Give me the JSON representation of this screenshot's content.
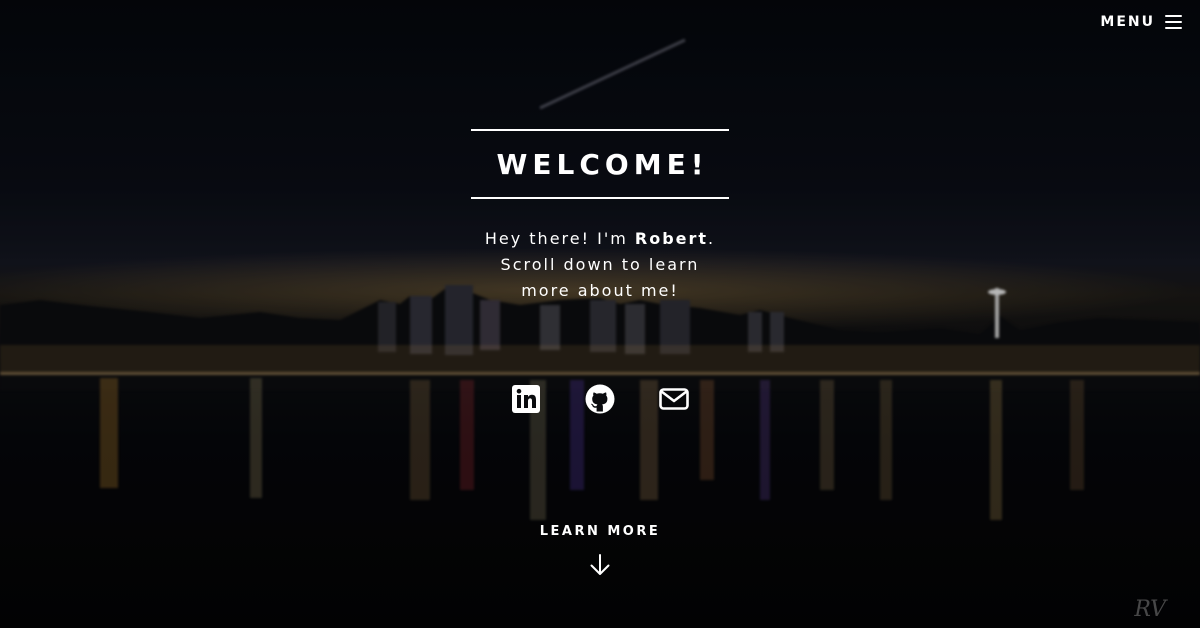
{
  "header": {
    "menu_label": "MENU",
    "menu_icon": "hamburger-icon"
  },
  "hero": {
    "title": "WELCOME!",
    "intro_prefix": "Hey there! I'm ",
    "intro_name": "Robert",
    "intro_suffix": ".",
    "intro_line2": "Scroll down to learn",
    "intro_line3": "more about me!"
  },
  "socials": [
    {
      "icon": "linkedin-icon",
      "label": "LinkedIn"
    },
    {
      "icon": "github-icon",
      "label": "GitHub"
    },
    {
      "icon": "mail-icon",
      "label": "Email"
    }
  ],
  "learn_more": {
    "label": "LEARN MORE",
    "icon": "arrow-down-icon"
  },
  "signature": {
    "text": "RV"
  },
  "colors": {
    "text": "#ffffff",
    "background": "#050608"
  }
}
